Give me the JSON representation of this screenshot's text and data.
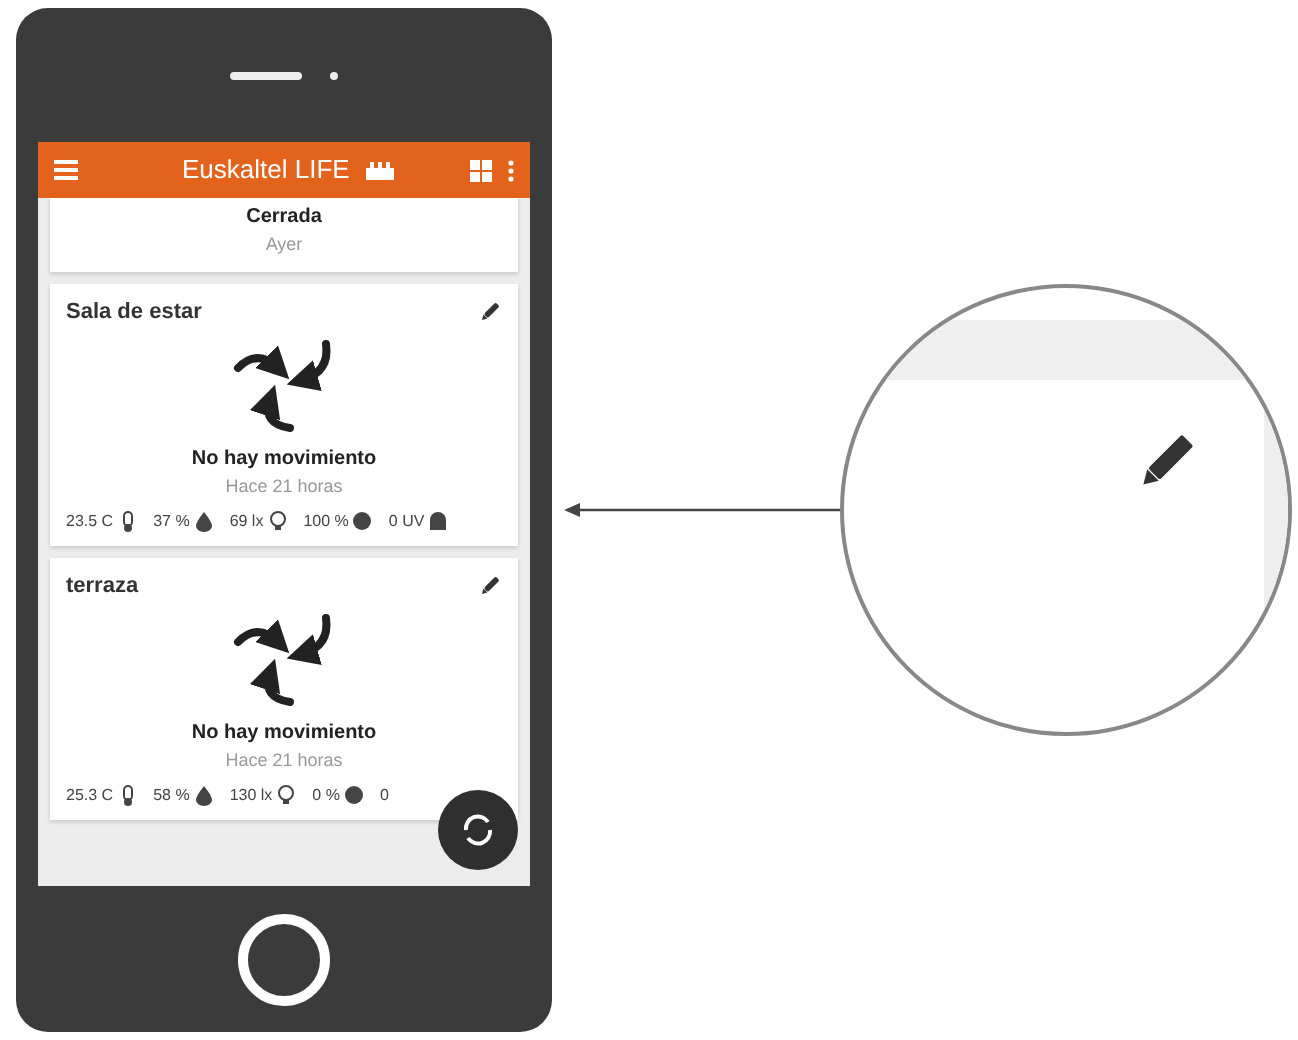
{
  "app_bar": {
    "title": "Euskaltel LIFE"
  },
  "cards": [
    {
      "kind": "partial",
      "status": "Cerrada",
      "time": "Ayer"
    },
    {
      "kind": "room",
      "title": "Sala de estar",
      "status": "No hay movimiento",
      "time": "Hace 21 horas",
      "sensors": [
        {
          "kind": "temperature",
          "value": "23.5 C"
        },
        {
          "kind": "humidity",
          "value": "37 %"
        },
        {
          "kind": "light",
          "value": "69 lx"
        },
        {
          "kind": "battery",
          "value": "100 %"
        },
        {
          "kind": "uv",
          "value": "0 UV"
        }
      ]
    },
    {
      "kind": "room",
      "title": "terraza",
      "status": "No hay movimiento",
      "time": "Hace 21 horas",
      "sensors": [
        {
          "kind": "temperature",
          "value": "25.3 C"
        },
        {
          "kind": "humidity",
          "value": "58 %"
        },
        {
          "kind": "light",
          "value": "130 lx"
        },
        {
          "kind": "battery",
          "value": "0 %"
        },
        {
          "kind": "uv",
          "value": "0"
        }
      ]
    }
  ]
}
